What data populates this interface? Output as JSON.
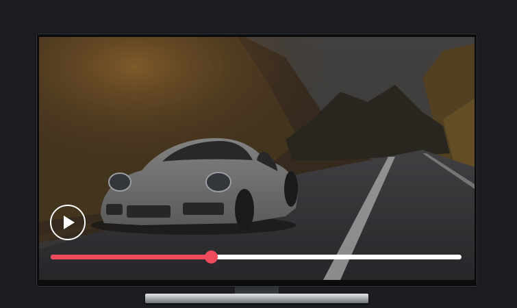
{
  "player": {
    "progress_fraction": 0.39,
    "colors": {
      "progress_fill": "#ee4b5d",
      "progress_track": "#ffffff",
      "play_button": "#ffffff",
      "background": "#1b1d22"
    },
    "icons": {
      "play": "play-icon"
    }
  }
}
